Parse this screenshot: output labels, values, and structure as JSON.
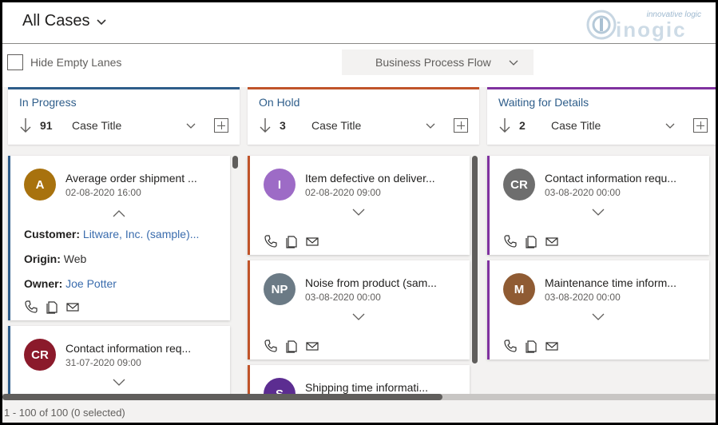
{
  "header": {
    "view_title": "All Cases",
    "brand_tagline": "innovative logic",
    "brand_name": "inogic"
  },
  "filters": {
    "hide_empty_lanes_label": "Hide Empty Lanes",
    "hide_empty_lanes_checked": false,
    "business_process_flow_label": "Business Process Flow"
  },
  "lanes": [
    {
      "name": "In Progress",
      "count": "91",
      "sort_field": "Case Title",
      "accent": "#2e5d8a",
      "cards": [
        {
          "initials": "A",
          "avatar_color": "#a8720e",
          "title": "Average order shipment ...",
          "date": "02-08-2020 16:00",
          "expanded": true,
          "customer_label": "Customer:",
          "customer_value": "Litware, Inc. (sample)...",
          "origin_label": "Origin:",
          "origin_value": "Web",
          "owner_label": "Owner:",
          "owner_value": "Joe Potter"
        },
        {
          "initials": "CR",
          "avatar_color": "#8b1a2b",
          "title": "Contact information req...",
          "date": "31-07-2020 09:00"
        }
      ]
    },
    {
      "name": "On Hold",
      "count": "3",
      "sort_field": "Case Title",
      "accent": "#c0542a",
      "cards": [
        {
          "initials": "I",
          "avatar_color": "#9d6bc6",
          "title": "Item defective on deliver...",
          "date": "02-08-2020 09:00"
        },
        {
          "initials": "NP",
          "avatar_color": "#6b7a85",
          "title": "Noise from product (sam...",
          "date": "03-08-2020 00:00"
        },
        {
          "initials": "S",
          "avatar_color": "#5c2d91",
          "title": "Shipping time informati...",
          "date": ""
        }
      ]
    },
    {
      "name": "Waiting for Details",
      "count": "2",
      "sort_field": "Case Title",
      "accent": "#8032a0",
      "cards": [
        {
          "initials": "CR",
          "avatar_color": "#6e6e6e",
          "title": "Contact information requ...",
          "date": "03-08-2020 00:00"
        },
        {
          "initials": "M",
          "avatar_color": "#8f5b33",
          "title": "Maintenance time inform...",
          "date": "03-08-2020 00:00"
        }
      ]
    }
  ],
  "footer": {
    "status": "1 - 100 of 100 (0 selected)"
  },
  "icons": [
    "chevron-down-icon",
    "sort-arrow-icon",
    "add-icon",
    "chevron-up-icon",
    "phone-icon",
    "document-icon",
    "email-icon",
    "brand-logo-icon"
  ]
}
